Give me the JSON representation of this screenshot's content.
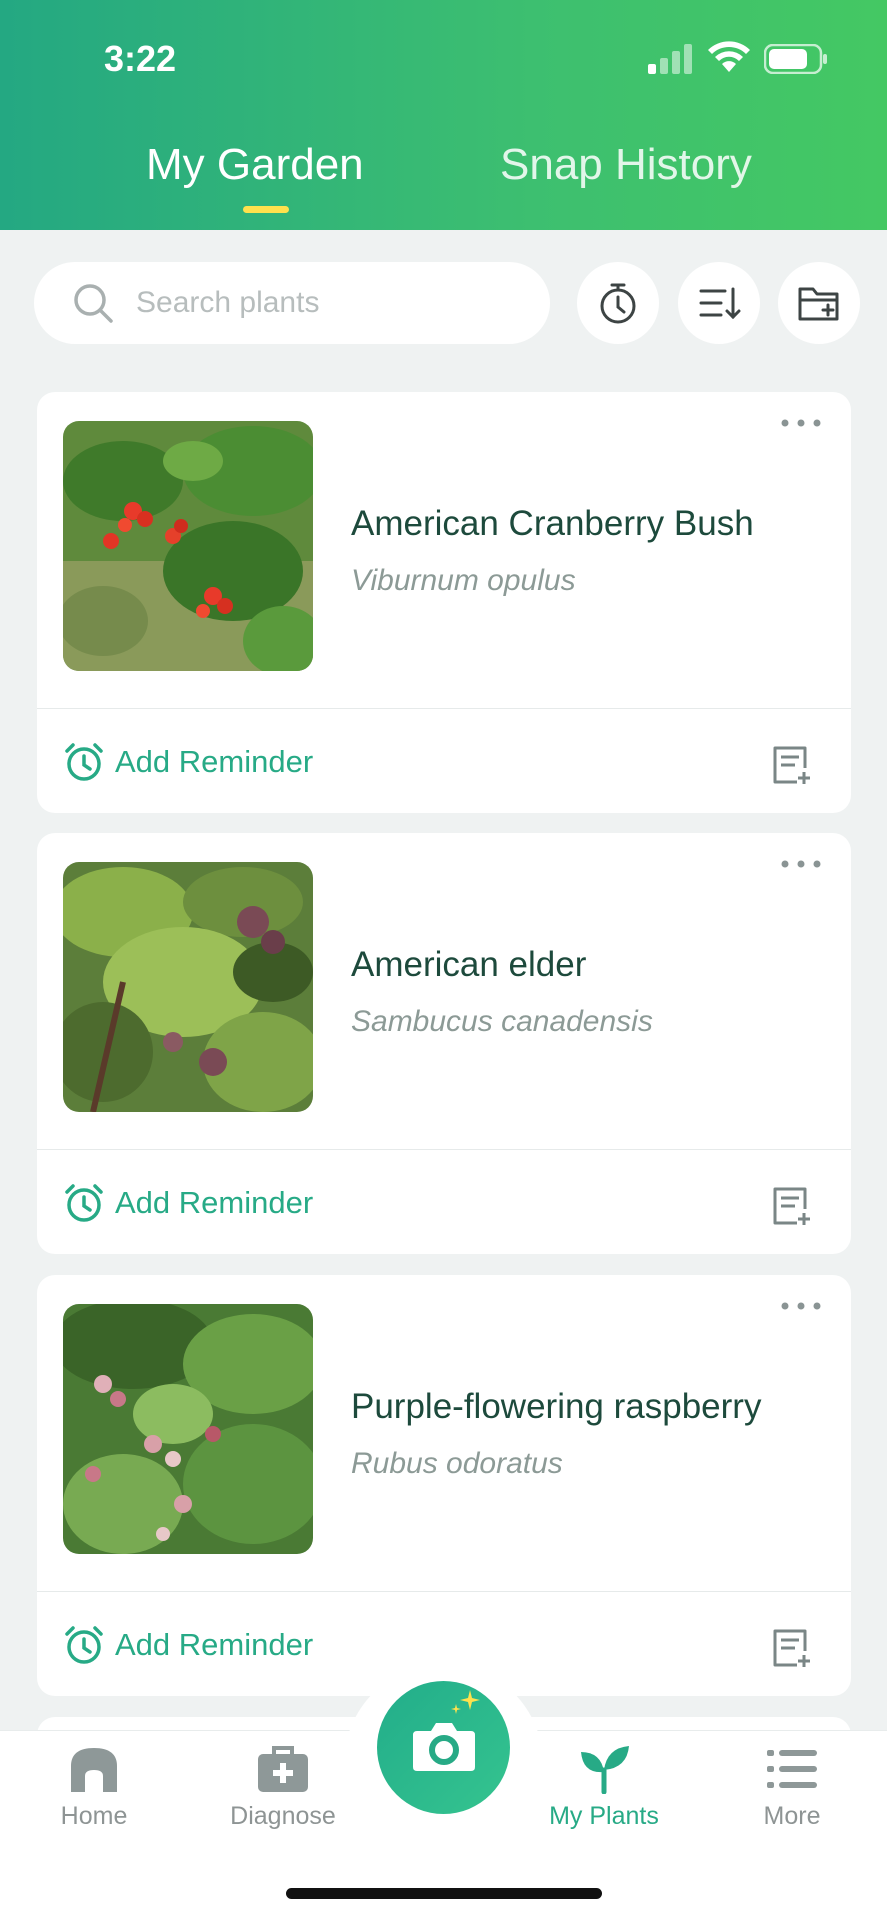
{
  "status_bar": {
    "time": "3:22"
  },
  "tabs": [
    {
      "label": "My Garden",
      "active": true
    },
    {
      "label": "Snap History",
      "active": false
    }
  ],
  "search": {
    "placeholder": "Search plants",
    "value": ""
  },
  "toolbar_icons": [
    "timer-icon",
    "sort-icon",
    "add-folder-icon"
  ],
  "plants": [
    {
      "name": "American Cranberry Bush",
      "scientific": "Viburnum opulus",
      "reminder_label": "Add Reminder"
    },
    {
      "name": "American elder",
      "scientific": "Sambucus canadensis",
      "reminder_label": "Add Reminder"
    },
    {
      "name": "Purple-flowering raspberry",
      "scientific": "Rubus odoratus",
      "reminder_label": "Add Reminder"
    }
  ],
  "bottom_nav": {
    "items": [
      {
        "label": "Home",
        "icon": "home-icon",
        "active": false
      },
      {
        "label": "Diagnose",
        "icon": "medical-kit-icon",
        "active": false
      },
      {
        "label": "My Plants",
        "icon": "sprout-icon",
        "active": true
      },
      {
        "label": "More",
        "icon": "list-icon",
        "active": false
      }
    ],
    "center_icon": "camera-icon"
  },
  "colors": {
    "accent": "#27aa86",
    "header_start": "#24a882",
    "header_end": "#44c863",
    "tab_indicator": "#ffe14d"
  }
}
